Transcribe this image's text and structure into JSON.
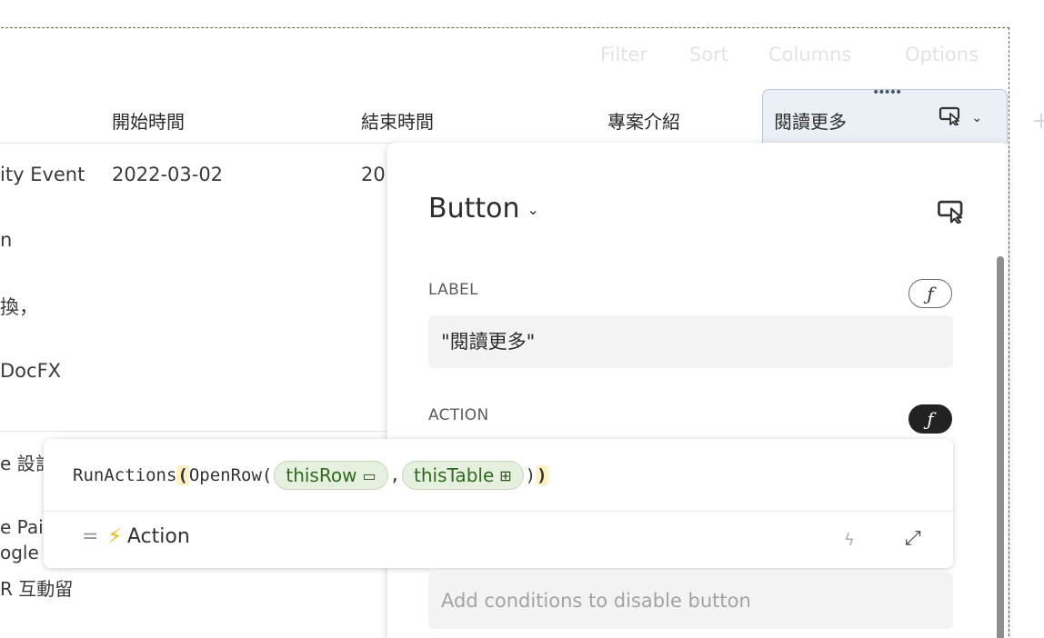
{
  "toolbar": {
    "filter": "Filter",
    "sort": "Sort",
    "columns": "Columns",
    "options": "Options"
  },
  "columns": [
    {
      "label": "開始時間"
    },
    {
      "label": "結束時間"
    },
    {
      "label": "專案介紹"
    },
    {
      "label": "閱讀更多",
      "icon": "button-cursor-icon"
    }
  ],
  "rows": {
    "title_fragment": "ity Event",
    "start": "2022-03-02",
    "end_fragment": "20",
    "desc_fragments": [
      "n",
      "換，",
      "DocFX"
    ],
    "lower_fragments": [
      "e 設計",
      "e Pair",
      "ogle",
      "R 互動留"
    ]
  },
  "panel": {
    "title": "Button",
    "label_section": "LABEL",
    "label_value": "\"閱讀更多\"",
    "action_section": "ACTION",
    "disable_placeholder": "Add conditions to disable button",
    "fx": "ƒ"
  },
  "formula": {
    "func": "RunActions",
    "open_paren": "(",
    "inner_func": "OpenRow(",
    "chip1": "thisRow",
    "comma": ",",
    "chip2": "thisTable",
    "inner_close": ")",
    "close_paren": ")",
    "result_eq": "=",
    "result_label": "Action"
  },
  "colors": {
    "accent_green": "#2f6a1e",
    "dashed_border": "#4a7a2a",
    "selected_col": "#eaf0f6"
  }
}
